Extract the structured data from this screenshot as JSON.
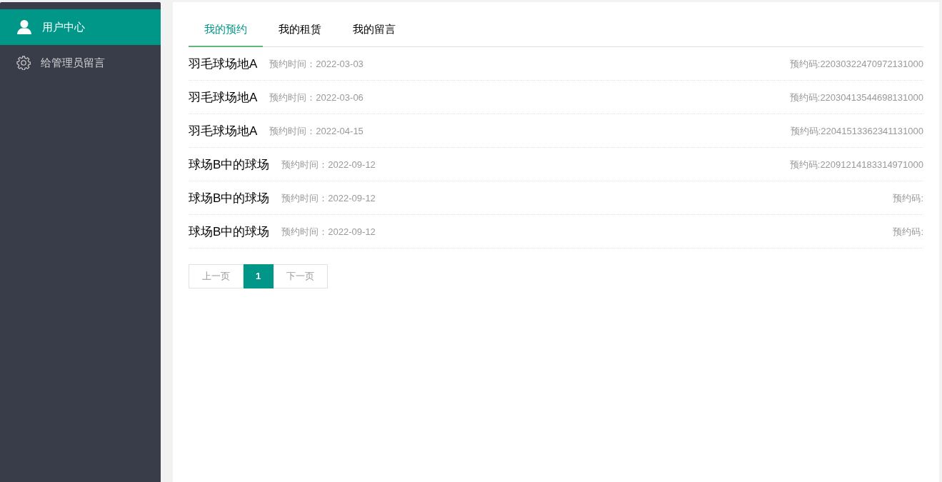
{
  "sidebar": {
    "items": [
      {
        "label": "用户中心",
        "kind": "user",
        "selected": true
      },
      {
        "label": "给管理员留言",
        "kind": "settings",
        "selected": false
      }
    ]
  },
  "tabs": [
    {
      "label": "我的预约",
      "selected": true
    },
    {
      "label": "我的租赁",
      "selected": false
    },
    {
      "label": "我的留言",
      "selected": false
    }
  ],
  "reservations": [
    {
      "venue": "羽毛球场地A",
      "time": "预约时间：2022-03-03",
      "code": "预约码:22030322470972131000"
    },
    {
      "venue": "羽毛球场地A",
      "time": "预约时间：2022-03-06",
      "code": "预约码:22030413544698131000"
    },
    {
      "venue": "羽毛球场地A",
      "time": "预约时间：2022-04-15",
      "code": "预约码:22041513362341131000"
    },
    {
      "venue": "球场B中的球场",
      "time": "预约时间：2022-09-12",
      "code": "预约码:22091214183314971000"
    },
    {
      "venue": "球场B中的球场",
      "time": "预约时间：2022-09-12",
      "code": "预约码:"
    },
    {
      "venue": "球场B中的球场",
      "time": "预约时间：2022-09-12",
      "code": "预约码:"
    }
  ],
  "pagination": {
    "prev": {
      "label": "上一页",
      "disabled": true
    },
    "pages": [
      {
        "label": "1",
        "selected": true
      }
    ],
    "next": {
      "label": "下一页",
      "disabled": true
    }
  }
}
